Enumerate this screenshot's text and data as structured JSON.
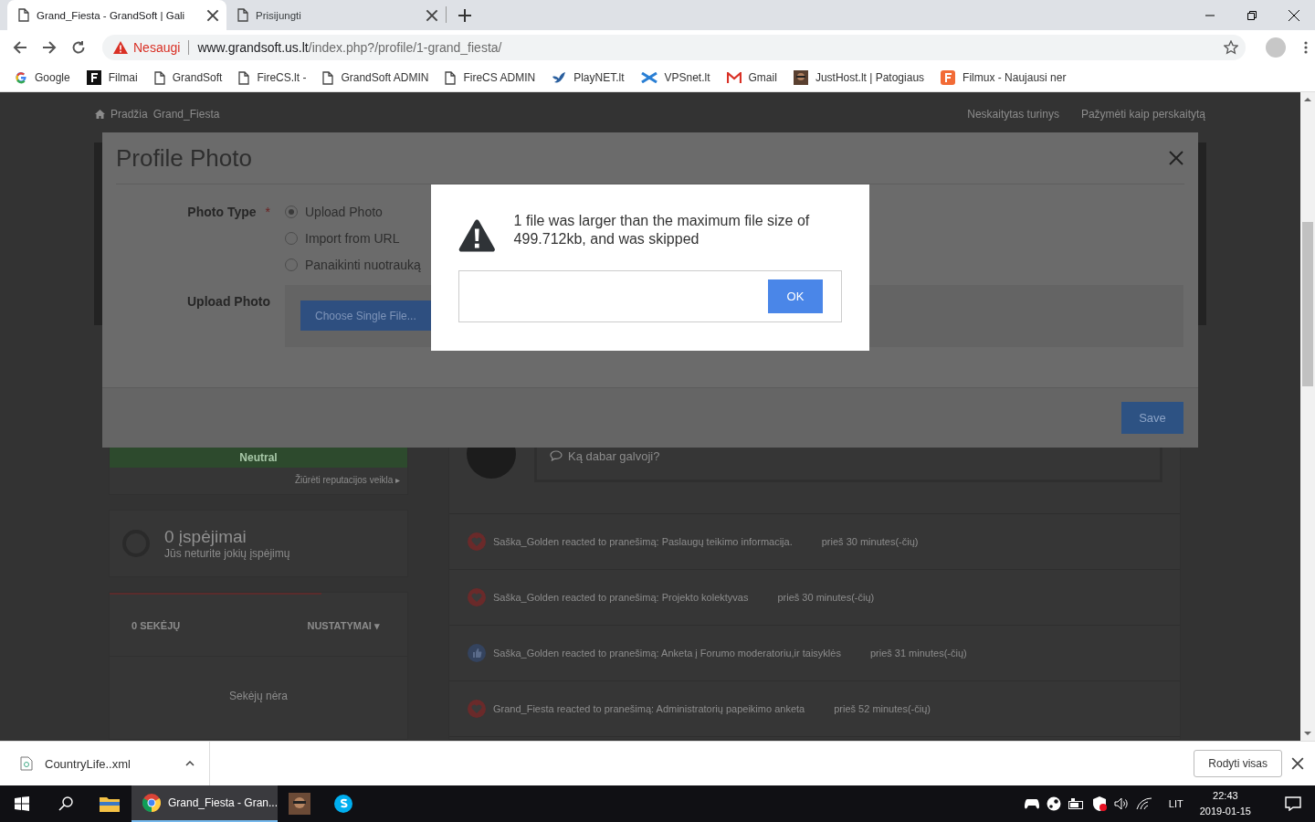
{
  "browser": {
    "tabs": [
      {
        "title": "Grand_Fiesta - GrandSoft | Gali",
        "selected": true
      },
      {
        "title": "Prisijungti",
        "selected": false
      }
    ],
    "security_label": "Nesaugi",
    "url_host": "www.grandsoft.us.lt",
    "url_path": "/index.php?/profile/1-grand_fiesta/",
    "bookmarks": [
      {
        "kind": "google",
        "label": "Google"
      },
      {
        "kind": "square",
        "label": "Filmai"
      },
      {
        "kind": "page",
        "label": "GrandSoft"
      },
      {
        "kind": "page",
        "label": "FireCS.lt -"
      },
      {
        "kind": "page",
        "label": "GrandSoft ADMIN"
      },
      {
        "kind": "page",
        "label": "FireCS ADMIN"
      },
      {
        "kind": "bird",
        "label": "PlayNET.lt"
      },
      {
        "kind": "cross",
        "label": "VPSnet.lt"
      },
      {
        "kind": "mail",
        "label": "Gmail"
      },
      {
        "kind": "photo",
        "label": "JustHost.lt | Patogiaus"
      },
      {
        "kind": "orange",
        "label": "Filmux - Naujausi ner"
      }
    ]
  },
  "page": {
    "breadcrumb": [
      "Pradžia",
      "Grand_Fiesta"
    ],
    "top_links": [
      "Neskaitytas turinys",
      "Pažymėti kaip perskaitytą"
    ],
    "reputation": {
      "label": "Neutral",
      "link": "Žiūrėti reputacijos veikla",
      "link_arrow": "▸"
    },
    "warnings": {
      "title": "0 įspėjimai",
      "subtitle": "Jūs neturite jokių įspėjimų"
    },
    "followers": {
      "count": "0 SEKĖJŲ",
      "settings": "NUSTATYMAI",
      "settings_caret": "▾",
      "empty": "Sekėjų nėra"
    },
    "status_placeholder": "Ką dabar galvoji?",
    "activity": [
      {
        "kind": "love",
        "text": "Saška_Golden reacted to pranešimą: Paslaugų teikimo informacija.",
        "time": "prieš 30 minutes(-čių)"
      },
      {
        "kind": "love",
        "text": "Saška_Golden reacted to pranešimą: Projekto kolektyvas",
        "time": "prieš 30 minutes(-čių)"
      },
      {
        "kind": "like",
        "text": "Saška_Golden reacted to pranešimą: Anketa į Forumo moderatoriu,ir taisyklės",
        "time": "prieš 31 minutes(-čių)"
      },
      {
        "kind": "love",
        "text": "Grand_Fiesta reacted to pranešimą: Administratorių papeikimo anketa",
        "time": "prieš 52 minutes(-čių)"
      }
    ]
  },
  "profile_photo_modal": {
    "title": "Profile Photo",
    "photo_type_label": "Photo Type",
    "required_mark": "*",
    "options": [
      {
        "label": "Upload Photo",
        "selected": true
      },
      {
        "label": "Import from URL",
        "selected": false
      },
      {
        "label": "Panaikinti nuotrauką",
        "selected": false
      }
    ],
    "upload_label": "Upload Photo",
    "choose_button": "Choose Single File...",
    "save_button": "Save"
  },
  "alert": {
    "message": "1 file was larger than the maximum file size of 499.712kb, and was skipped",
    "ok_button": "OK"
  },
  "downloads": {
    "file": "CountryLife..xml",
    "show_all": "Rodyti visas"
  },
  "taskbar": {
    "chrome_window": "Grand_Fiesta - Gran...",
    "language": "LIT",
    "time": "22:43",
    "date": "2019-01-15"
  }
}
